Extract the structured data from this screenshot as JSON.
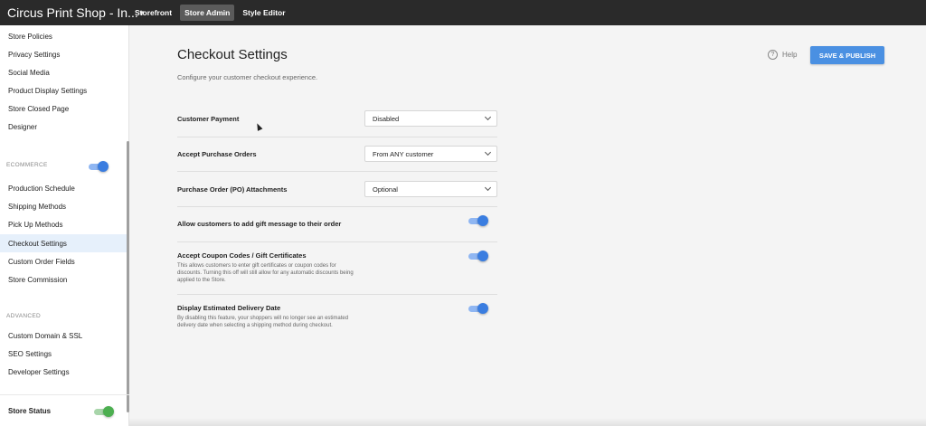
{
  "topbar": {
    "shop_name": "Circus Print Shop - In...",
    "tabs": [
      {
        "label": "Storefront",
        "active": false
      },
      {
        "label": "Store Admin",
        "active": true
      },
      {
        "label": "Style Editor",
        "active": false
      }
    ]
  },
  "sidebar": {
    "items_top": [
      {
        "label": "Store Policies"
      },
      {
        "label": "Privacy Settings"
      },
      {
        "label": "Social Media"
      },
      {
        "label": "Product Display Settings"
      },
      {
        "label": "Store Closed Page"
      },
      {
        "label": "Designer"
      }
    ],
    "ecommerce": {
      "section_label": "ECOMMERCE",
      "enabled": true,
      "items": [
        {
          "label": "Production Schedule"
        },
        {
          "label": "Shipping Methods"
        },
        {
          "label": "Pick Up Methods"
        },
        {
          "label": "Checkout Settings",
          "active": true
        },
        {
          "label": "Custom Order Fields"
        },
        {
          "label": "Store Commission"
        }
      ]
    },
    "advanced": {
      "section_label": "ADVANCED",
      "items": [
        {
          "label": "Custom Domain & SSL"
        },
        {
          "label": "SEO Settings"
        },
        {
          "label": "Developer Settings"
        }
      ]
    },
    "store_status": {
      "label": "Store Status",
      "enabled": true
    }
  },
  "main": {
    "title": "Checkout Settings",
    "subtitle": "Configure your customer checkout experience.",
    "help_label": "Help",
    "save_label": "SAVE & PUBLISH",
    "settings": {
      "customer_payment": {
        "label": "Customer Payment",
        "value": "Disabled"
      },
      "accept_po": {
        "label": "Accept Purchase Orders",
        "value": "From ANY customer"
      },
      "po_attachments": {
        "label": "Purchase Order (PO) Attachments",
        "value": "Optional"
      },
      "gift_message": {
        "label": "Allow customers to add gift message to their order",
        "enabled": true
      },
      "coupon_codes": {
        "label": "Accept Coupon Codes / Gift Certificates",
        "description": "This allows customers to enter gift certificates or coupon codes for discounts. Turning this off will still allow for any automatic discounts being applied to the Store.",
        "enabled": true
      },
      "delivery_date": {
        "label": "Display Estimated Delivery Date",
        "description": "By disabling this feature, your shoppers will no longer see an estimated delivery date when selecting a shipping method during checkout.",
        "enabled": true
      }
    }
  },
  "colors": {
    "topbar_bg": "#2a2a2a",
    "accent": "#4a90e2",
    "toggle_blue": "#3a7de0",
    "toggle_green": "#4caf50",
    "active_item_bg": "#e6f0fb"
  },
  "icons": {
    "shop_dropdown": "caret-down-icon",
    "help": "question-circle-icon",
    "select": "chevron-down-icon"
  }
}
